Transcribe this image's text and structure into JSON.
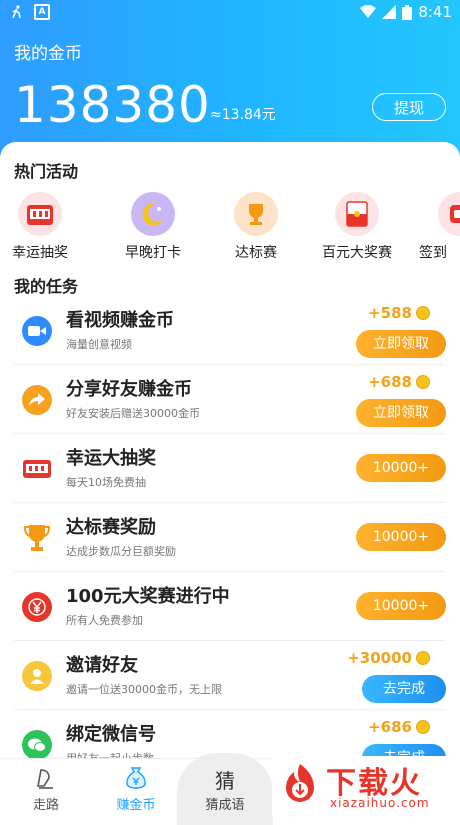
{
  "status_bar": {
    "time": "8:41",
    "colors": {
      "text": "#ffffff"
    }
  },
  "header": {
    "title": "我的金币",
    "balance": "138380",
    "approx": "≈13.84元",
    "withdraw_label": "提现",
    "colors": {
      "gradient_start": "#2f9cff",
      "gradient_end": "#24c6ff"
    }
  },
  "hot_activities": {
    "title": "热门活动",
    "items": [
      {
        "label": "幸运抽奖",
        "icon": "slot-machine-icon",
        "bg": "#fde3e3"
      },
      {
        "label": "早晚打卡",
        "icon": "moon-star-icon",
        "bg": "#c9b8f5"
      },
      {
        "label": "达标赛",
        "icon": "trophy-icon",
        "bg": "#fde3c8"
      },
      {
        "label": "百元大奖赛",
        "icon": "red-envelope-icon",
        "bg": "#fde3e3"
      },
      {
        "label": "签到",
        "icon": "checkin-icon",
        "bg": "#fde3e3"
      }
    ]
  },
  "tasks": {
    "title": "我的任务",
    "items": [
      {
        "name": "看视频赚金币",
        "sub": "海量创意视频",
        "reward": "+588",
        "button": "立即领取",
        "button_style": "orange",
        "icon": "video-camera-icon"
      },
      {
        "name": "分享好友赚金币",
        "sub": "好友安装后赠送30000金币",
        "reward": "+688",
        "button": "立即领取",
        "button_style": "orange",
        "icon": "share-arrow-icon"
      },
      {
        "name": "幸运大抽奖",
        "sub": "每天10场免费抽",
        "reward": "",
        "button": "10000+",
        "button_style": "orange",
        "icon": "slot-machine-icon"
      },
      {
        "name": "达标赛奖励",
        "sub": "达成步数瓜分巨额奖励",
        "reward": "",
        "button": "10000+",
        "button_style": "orange",
        "icon": "trophy-icon"
      },
      {
        "name": "100元大奖赛进行中",
        "sub": "所有人免费参加",
        "reward": "",
        "button": "10000+",
        "button_style": "orange",
        "icon": "yuan-coin-icon"
      },
      {
        "name": "邀请好友",
        "sub": "邀请一位送30000金币，无上限",
        "reward": "+30000",
        "button": "去完成",
        "button_style": "blue",
        "icon": "invite-person-icon"
      },
      {
        "name": "绑定微信号",
        "sub": "用好友一起小步数",
        "reward": "+686",
        "button": "去完成",
        "button_style": "blue",
        "icon": "wechat-icon"
      }
    ]
  },
  "bottom_nav": {
    "items": [
      {
        "label": "走路",
        "icon": "walk-icon",
        "active": false
      },
      {
        "label": "赚金币",
        "icon": "money-bag-icon",
        "active": true
      },
      {
        "label": "猜成语",
        "icon": "guess-char-icon",
        "glyph": "猜",
        "active": false
      }
    ]
  },
  "watermark": {
    "text": "下载火",
    "url": "xiazaihuo.com"
  },
  "colors": {
    "accent_blue": "#1da1ff",
    "accent_orange": "#f39a12",
    "reward_text": "#f3a21b"
  }
}
